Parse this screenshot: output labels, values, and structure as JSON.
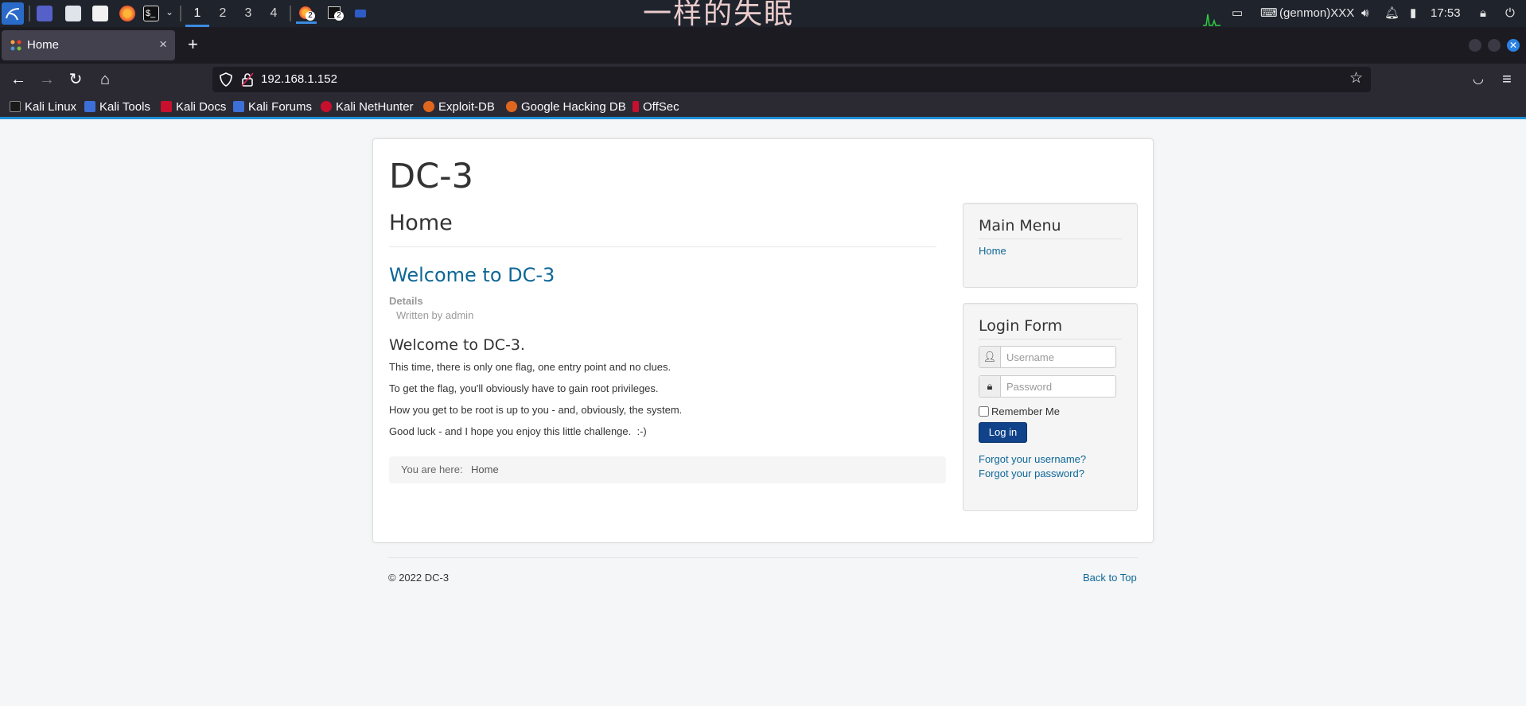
{
  "os_panel": {
    "workspaces": [
      "1",
      "2",
      "3",
      "4"
    ],
    "task_badge_1": "2",
    "task_badge_2": "2",
    "watermark_text": "一样的失眠",
    "genmon": "(genmon)XXX",
    "clock": "17:53"
  },
  "browser": {
    "tab_title": "Home",
    "url": "192.168.1.152",
    "tab_close": "×",
    "new_tab": "+",
    "bookmarks": [
      {
        "label": "Kali Linux",
        "color": "#1a1a1a"
      },
      {
        "label": "Kali Tools",
        "color": "#3c6fd8"
      },
      {
        "label": "Kali Docs",
        "color": "#c8102e"
      },
      {
        "label": "Kali Forums",
        "color": "#3c6fd8"
      },
      {
        "label": "Kali NetHunter",
        "color": "#c8102e"
      },
      {
        "label": "Exploit-DB",
        "color": "#e0661d"
      },
      {
        "label": "Google Hacking DB",
        "color": "#e0661d"
      },
      {
        "label": "OffSec",
        "color": "#c8102e"
      }
    ]
  },
  "site": {
    "brand": "DC-3",
    "page_heading": "Home",
    "article": {
      "title": "Welcome to DC-3",
      "details_label": "Details",
      "written_by": "Written by admin",
      "heading": "Welcome to DC-3.",
      "paragraphs": [
        "This time, there is only one flag, one entry point and no clues.",
        "To get the flag, you'll obviously have to gain root privileges.",
        "How you get to be root is up to you - and, obviously, the system.",
        "Good luck - and I hope you enjoy this little challenge.  :-)"
      ]
    },
    "breadcrumbs": {
      "label": "You are here:",
      "current": "Home"
    },
    "main_menu": {
      "title": "Main Menu",
      "items": [
        "Home"
      ]
    },
    "login_form": {
      "title": "Login Form",
      "username_placeholder": "Username",
      "password_placeholder": "Password",
      "remember_label": "Remember Me",
      "submit_label": "Log in",
      "forgot_username": "Forgot your username?",
      "forgot_password": "Forgot your password?"
    },
    "footer": {
      "copyright": "© 2022 DC-3",
      "back_to_top": "Back to Top"
    }
  },
  "colors": {
    "link": "#0e6797",
    "login_button": "#10438a",
    "accent_blue": "#1f8fd8"
  }
}
